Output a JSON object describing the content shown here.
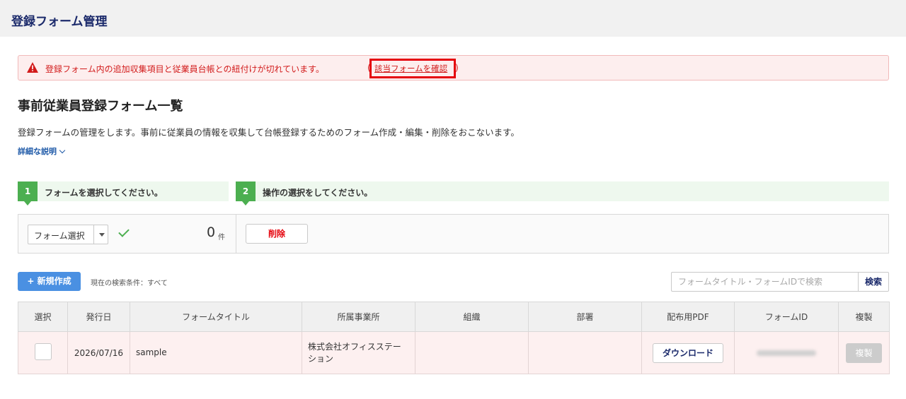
{
  "header": {
    "title": "登録フォーム管理"
  },
  "alert": {
    "message": "登録フォーム内の追加収集項目と従業員台帳との紐付けが切れています。",
    "paren_open": "(",
    "link_label": "該当フォームを確認",
    "paren_close": ")",
    "color": "#d21b1b"
  },
  "page": {
    "title": "事前従業員登録フォーム一覧",
    "description": "登録フォームの管理をします。事前に従業員の情報を収集して台帳登録するためのフォーム作成・編集・削除をおこないます。",
    "detail_link": "詳細な説明"
  },
  "steps": [
    {
      "number": "1",
      "label": "フォームを選択してください。"
    },
    {
      "number": "2",
      "label": "操作の選択をしてください。"
    }
  ],
  "operations": {
    "select_label": "フォーム選択",
    "count": "0",
    "count_unit": "件",
    "delete_label": "削除"
  },
  "toolbar": {
    "new_label": "+ 新規作成",
    "search_condition": "現在の検索条件：すべて",
    "search_placeholder": "フォームタイトル・フォームIDで検索",
    "search_button": "検索"
  },
  "table": {
    "headers": [
      "選択",
      "発行日",
      "フォームタイトル",
      "所属事業所",
      "組織",
      "部署",
      "配布用PDF",
      "フォームID",
      "複製"
    ],
    "rows": [
      {
        "date": "2026/07/16",
        "title": "sample",
        "office": "株式会社オフィスステーション",
        "organization": "",
        "department": "",
        "pdf_button": "ダウンロード",
        "form_id": "",
        "duplicate_button": "複製"
      }
    ]
  },
  "colors": {
    "accent": "#4a90e2",
    "step": "#4caf50",
    "danger": "#e5000a",
    "navy": "#1b2a6b"
  }
}
